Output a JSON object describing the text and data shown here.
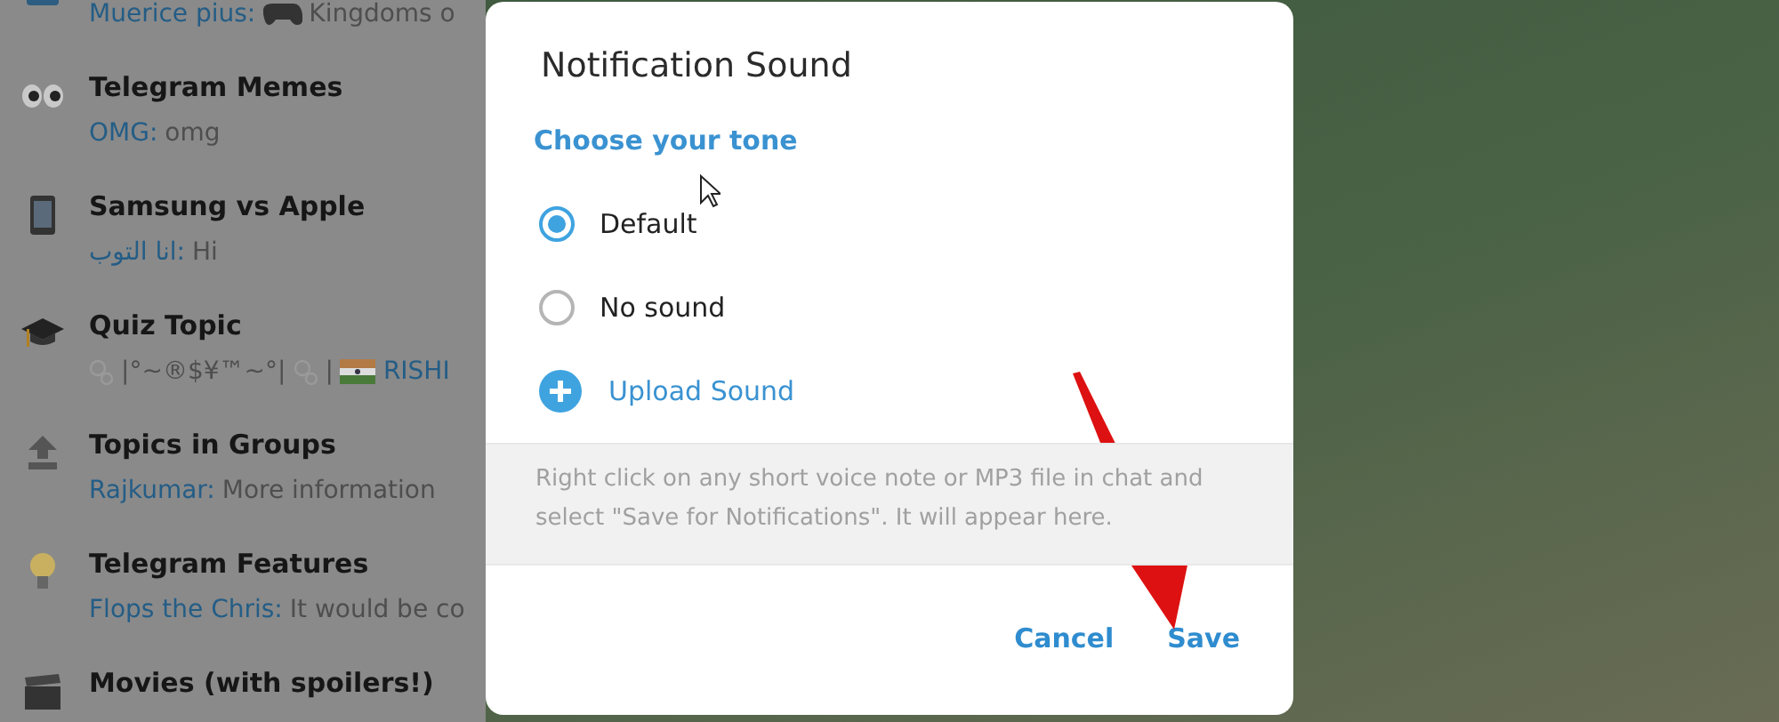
{
  "chat_list": [
    {
      "preview": [
        {
          "kind": "sender",
          "text": "Muerice pius:"
        },
        {
          "kind": "gamepad"
        },
        {
          "kind": "text",
          "text": "Kingdoms o"
        }
      ]
    },
    {
      "title": "Telegram Memes",
      "preview": [
        {
          "kind": "sender",
          "text": "OMG:"
        },
        {
          "kind": "text",
          "text": "omg"
        }
      ]
    },
    {
      "title": "Samsung vs Apple",
      "preview": [
        {
          "kind": "sender",
          "text": "انا التوب:"
        },
        {
          "kind": "text",
          "text": "Hi"
        }
      ]
    },
    {
      "title": "Quiz Topic",
      "preview": [
        {
          "kind": "bubbles"
        },
        {
          "kind": "text",
          "text": "|°~®$¥™~°|"
        },
        {
          "kind": "bubbles"
        },
        {
          "kind": "text",
          "text": "|"
        },
        {
          "kind": "flag"
        },
        {
          "kind": "sender",
          "text": "RISHI"
        }
      ]
    },
    {
      "title": "Topics in Groups",
      "preview": [
        {
          "kind": "sender",
          "text": "Rajkumar:"
        },
        {
          "kind": "text",
          "text": "More information"
        }
      ]
    },
    {
      "title": "Telegram Features",
      "preview": [
        {
          "kind": "sender",
          "text": "Flops the Chris:"
        },
        {
          "kind": "text",
          "text": "It would be co"
        }
      ]
    },
    {
      "title": "Movies (with spoilers!)"
    }
  ],
  "dialog": {
    "title": "Notification Sound",
    "section": "Choose your tone",
    "options": [
      {
        "label": "Default",
        "selected": true
      },
      {
        "label": "No sound",
        "selected": false
      }
    ],
    "upload": "Upload Sound",
    "hint": "Right click on any short voice note or MP3 file in chat and select \"Save for Notifications\". It will appear here.",
    "buttons": [
      "Cancel",
      "Save"
    ]
  }
}
